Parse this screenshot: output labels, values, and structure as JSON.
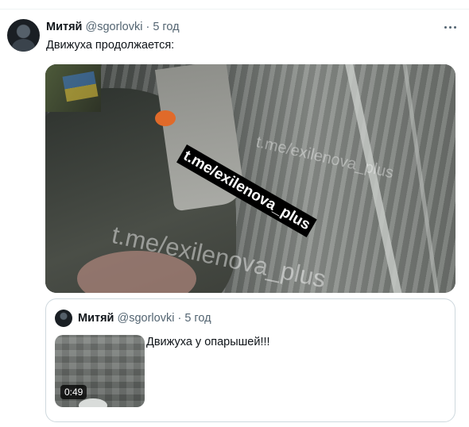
{
  "tweet": {
    "author_name": "Митяй",
    "handle": "@sgorlovki",
    "separator": "·",
    "time": "5 год",
    "text": "Движуха продолжается:"
  },
  "media": {
    "watermark_label": "t.me/exilenova_plus",
    "watermark_large": "t.me/exilenova_plus",
    "watermark_small": "t.me/exilenova_plus"
  },
  "quoted_tweet": {
    "author_name": "Митяй",
    "handle": "@sgorlovki",
    "separator": "·",
    "time": "5 год",
    "text": "Движуха у опарышей!!!",
    "video_duration": "0:49"
  },
  "icons": [
    "avatar",
    "more-options-icon"
  ],
  "colors": {
    "text": "#0f1419",
    "secondary": "#536471",
    "border": "#cfd9de"
  }
}
